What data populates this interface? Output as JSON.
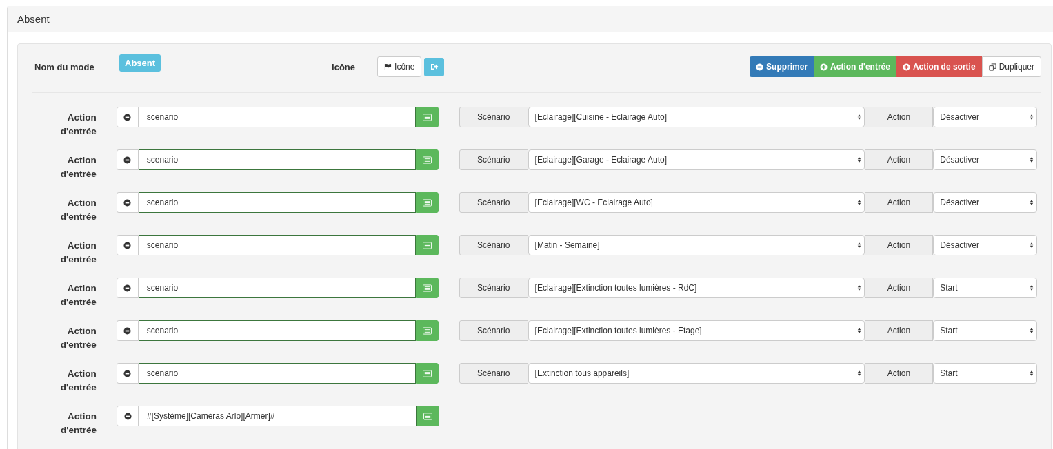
{
  "panel": {
    "title": "Absent"
  },
  "mode": {
    "name_label": "Nom du mode",
    "name": "Absent",
    "icon_label": "Icône",
    "icon_button": "Icône"
  },
  "buttons": [
    {
      "label": "Supprimer",
      "kind": "remove"
    },
    {
      "label": "Action d'entrée",
      "kind": "add-entry"
    },
    {
      "label": "Action de sortie",
      "kind": "add-exit"
    },
    {
      "label": "Dupliquer",
      "kind": "duplicate"
    }
  ],
  "actions": [
    {
      "label": "Action d'entrée",
      "command": "scenario",
      "kind": "scenario",
      "scenario_label": "Scénario",
      "scenario": "[Eclairage][Cuisine - Eclairage Auto]",
      "action_label": "Action",
      "action": "Désactiver"
    },
    {
      "label": "Action d'entrée",
      "command": "scenario",
      "kind": "scenario",
      "scenario_label": "Scénario",
      "scenario": "[Eclairage][Garage - Eclairage Auto]",
      "action_label": "Action",
      "action": "Désactiver"
    },
    {
      "label": "Action d'entrée",
      "command": "scenario",
      "kind": "scenario",
      "scenario_label": "Scénario",
      "scenario": "[Eclairage][WC - Eclairage Auto]",
      "action_label": "Action",
      "action": "Désactiver"
    },
    {
      "label": "Action d'entrée",
      "command": "scenario",
      "kind": "scenario",
      "scenario_label": "Scénario",
      "scenario": "[Matin - Semaine]",
      "action_label": "Action",
      "action": "Désactiver"
    },
    {
      "label": "Action d'entrée",
      "command": "scenario",
      "kind": "scenario",
      "scenario_label": "Scénario",
      "scenario": "[Eclairage][Extinction toutes lumières - RdC]",
      "action_label": "Action",
      "action": "Start"
    },
    {
      "label": "Action d'entrée",
      "command": "scenario",
      "kind": "scenario",
      "scenario_label": "Scénario",
      "scenario": "[Eclairage][Extinction toutes lumières - Etage]",
      "action_label": "Action",
      "action": "Start"
    },
    {
      "label": "Action d'entrée",
      "command": "scenario",
      "kind": "scenario",
      "scenario_label": "Scénario",
      "scenario": "[Extinction tous appareils]",
      "action_label": "Action",
      "action": "Start"
    },
    {
      "label": "Action d'entrée",
      "command": "#[Système][Caméras Arlo][Armer]#",
      "kind": "command"
    }
  ]
}
